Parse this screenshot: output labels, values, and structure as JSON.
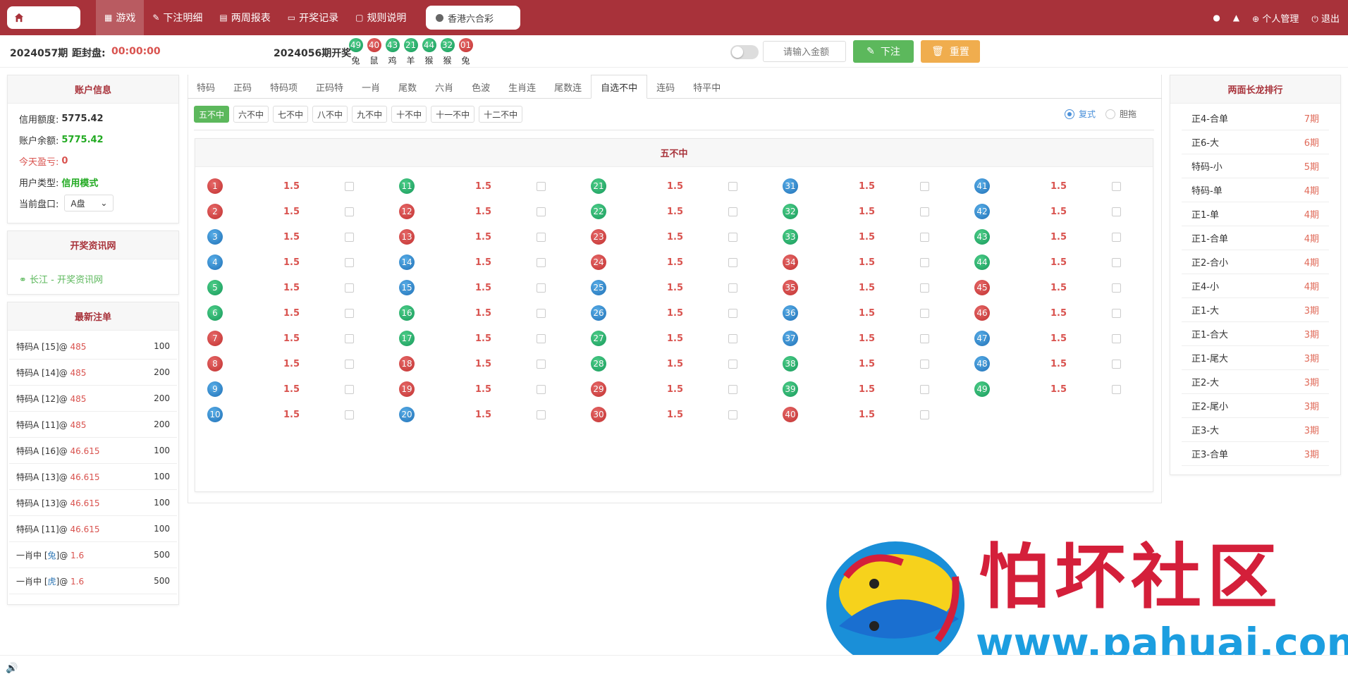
{
  "nav": {
    "items": [
      {
        "label": "游戏",
        "icon": "grid-icon"
      },
      {
        "label": "下注明细",
        "icon": "edit-icon"
      },
      {
        "label": "两周报表",
        "icon": "list-icon"
      },
      {
        "label": "开奖记录",
        "icon": "monitor-icon"
      },
      {
        "label": "规则说明",
        "icon": "doc-icon"
      }
    ],
    "lottery": "香港六合彩",
    "right": {
      "profile": "个人管理",
      "logout": "退出"
    }
  },
  "status": {
    "period": "2024057期",
    "close_label": "距封盘:",
    "countdown": "00:00:00",
    "open_label": "2024056期开奖",
    "draw": [
      {
        "num": "49",
        "zod": "兔",
        "color": "green"
      },
      {
        "num": "40",
        "zod": "鼠",
        "color": "red"
      },
      {
        "num": "43",
        "zod": "鸡",
        "color": "green"
      },
      {
        "num": "21",
        "zod": "羊",
        "color": "green"
      },
      {
        "num": "44",
        "zod": "猴",
        "color": "green"
      },
      {
        "num": "32",
        "zod": "猴",
        "color": "green"
      },
      {
        "num": "01",
        "zod": "兔",
        "color": "red"
      }
    ],
    "amount_placeholder": "请输入金额",
    "bet_label": "下注",
    "reset_label": "重置"
  },
  "account": {
    "title": "账户信息",
    "rows": [
      {
        "k": "信用额度:",
        "v": "5775.42",
        "color": "#333333"
      },
      {
        "k": "账户余额:",
        "v": "5775.42",
        "color": "#22aa22"
      },
      {
        "k": "今天盈亏:",
        "v": "0",
        "color": "#d9534f"
      },
      {
        "k": "用户类型:",
        "v": "信用模式",
        "color": "#22aa22"
      }
    ],
    "market_label": "当前盘口:",
    "market_value": "A盘"
  },
  "info": {
    "title": "开奖资讯网",
    "link": "长江 - 开奖资讯网"
  },
  "latest": {
    "title": "最新注单",
    "rows": [
      {
        "name": "特码A [15]@ ",
        "odds": "485",
        "amt": "100"
      },
      {
        "name": "特码A [14]@ ",
        "odds": "485",
        "amt": "200"
      },
      {
        "name": "特码A [12]@ ",
        "odds": "485",
        "amt": "200"
      },
      {
        "name": "特码A [11]@ ",
        "odds": "485",
        "amt": "200"
      },
      {
        "name": "特码A [16]@ ",
        "odds": "46.615",
        "amt": "100"
      },
      {
        "name": "特码A [13]@ ",
        "odds": "46.615",
        "amt": "100"
      },
      {
        "name": "特码A [13]@ ",
        "odds": "46.615",
        "amt": "100"
      },
      {
        "name": "特码A [11]@ ",
        "odds": "46.615",
        "amt": "100"
      },
      {
        "name": "一肖中 [",
        "sign": "兔",
        "name2": "]@ ",
        "odds": "1.6",
        "amt": "500"
      },
      {
        "name": "一肖中 [",
        "sign": "虎",
        "name2": "]@ ",
        "odds": "1.6",
        "amt": "500"
      }
    ]
  },
  "tabs": [
    "特码",
    "正码",
    "特码项",
    "正码特",
    "一肖",
    "尾数",
    "六肖",
    "色波",
    "生肖连",
    "尾数连",
    "自选不中",
    "连码",
    "特平中"
  ],
  "active_tab": 10,
  "subtabs": [
    "五不中",
    "六不中",
    "七不中",
    "八不中",
    "九不中",
    "十不中",
    "十一不中",
    "十二不中"
  ],
  "radios": [
    "复式",
    "胆拖"
  ],
  "grid": {
    "title": "五不中",
    "odds": "1.5",
    "numbers": [
      {
        "n": "1",
        "c": "red"
      },
      {
        "n": "2",
        "c": "red"
      },
      {
        "n": "3",
        "c": "blue"
      },
      {
        "n": "4",
        "c": "blue"
      },
      {
        "n": "5",
        "c": "green"
      },
      {
        "n": "6",
        "c": "green"
      },
      {
        "n": "7",
        "c": "red"
      },
      {
        "n": "8",
        "c": "red"
      },
      {
        "n": "9",
        "c": "blue"
      },
      {
        "n": "10",
        "c": "blue"
      },
      {
        "n": "11",
        "c": "green"
      },
      {
        "n": "12",
        "c": "red"
      },
      {
        "n": "13",
        "c": "red"
      },
      {
        "n": "14",
        "c": "blue"
      },
      {
        "n": "15",
        "c": "blue"
      },
      {
        "n": "16",
        "c": "green"
      },
      {
        "n": "17",
        "c": "green"
      },
      {
        "n": "18",
        "c": "red"
      },
      {
        "n": "19",
        "c": "red"
      },
      {
        "n": "20",
        "c": "blue"
      },
      {
        "n": "21",
        "c": "green"
      },
      {
        "n": "22",
        "c": "green"
      },
      {
        "n": "23",
        "c": "red"
      },
      {
        "n": "24",
        "c": "red"
      },
      {
        "n": "25",
        "c": "blue"
      },
      {
        "n": "26",
        "c": "blue"
      },
      {
        "n": "27",
        "c": "green"
      },
      {
        "n": "28",
        "c": "green"
      },
      {
        "n": "29",
        "c": "red"
      },
      {
        "n": "30",
        "c": "red"
      },
      {
        "n": "31",
        "c": "blue"
      },
      {
        "n": "32",
        "c": "green"
      },
      {
        "n": "33",
        "c": "green"
      },
      {
        "n": "34",
        "c": "red"
      },
      {
        "n": "35",
        "c": "red"
      },
      {
        "n": "36",
        "c": "blue"
      },
      {
        "n": "37",
        "c": "blue"
      },
      {
        "n": "38",
        "c": "green"
      },
      {
        "n": "39",
        "c": "green"
      },
      {
        "n": "40",
        "c": "red"
      },
      {
        "n": "41",
        "c": "blue"
      },
      {
        "n": "42",
        "c": "blue"
      },
      {
        "n": "43",
        "c": "green"
      },
      {
        "n": "44",
        "c": "green"
      },
      {
        "n": "45",
        "c": "red"
      },
      {
        "n": "46",
        "c": "red"
      },
      {
        "n": "47",
        "c": "blue"
      },
      {
        "n": "48",
        "c": "blue"
      },
      {
        "n": "49",
        "c": "green"
      }
    ]
  },
  "ranking": {
    "title": "两面长龙排行",
    "rows": [
      {
        "name": "正4-合单",
        "p": "7期"
      },
      {
        "name": "正6-大",
        "p": "6期"
      },
      {
        "name": "特码-小",
        "p": "5期"
      },
      {
        "name": "特码-单",
        "p": "4期"
      },
      {
        "name": "正1-单",
        "p": "4期"
      },
      {
        "name": "正1-合单",
        "p": "4期"
      },
      {
        "name": "正2-合小",
        "p": "4期"
      },
      {
        "name": "正4-小",
        "p": "4期"
      },
      {
        "name": "正1-大",
        "p": "3期"
      },
      {
        "name": "正1-合大",
        "p": "3期"
      },
      {
        "name": "正1-尾大",
        "p": "3期"
      },
      {
        "name": "正2-大",
        "p": "3期"
      },
      {
        "name": "正2-尾小",
        "p": "3期"
      },
      {
        "name": "正3-大",
        "p": "3期"
      },
      {
        "name": "正3-合单",
        "p": "3期"
      }
    ]
  },
  "watermark": {
    "text": "怕坏社区",
    "url": "www.pahuai.com"
  }
}
